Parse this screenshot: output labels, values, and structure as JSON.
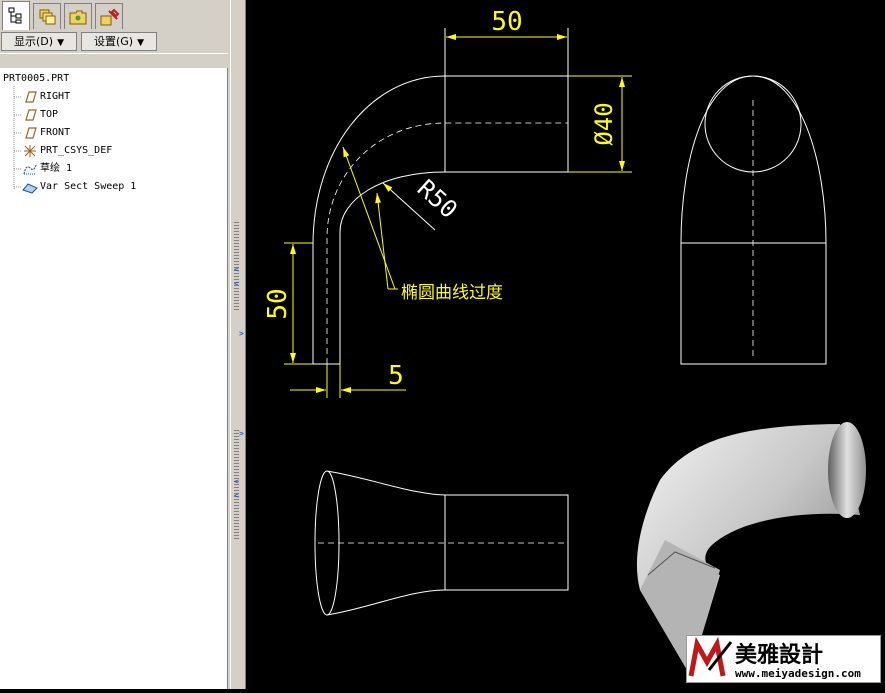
{
  "tabs": [
    {
      "name": "model-tree-tab",
      "icon": "model-tree-icon",
      "active": true
    },
    {
      "name": "layers-tab",
      "icon": "layers-icon",
      "active": false
    },
    {
      "name": "folder-browser-tab",
      "icon": "folder-icon",
      "active": false
    },
    {
      "name": "favorites-tab",
      "icon": "tools-icon",
      "active": false
    }
  ],
  "menus": {
    "show_label": "显示(D)",
    "settings_label": "设置(G)"
  },
  "tree": {
    "root": "PRT0005.PRT",
    "items": [
      {
        "label": "RIGHT",
        "icon": "datum-plane-icon"
      },
      {
        "label": "TOP",
        "icon": "datum-plane-icon"
      },
      {
        "label": "FRONT",
        "icon": "datum-plane-icon"
      },
      {
        "label": "PRT_CSYS_DEF",
        "icon": "csys-icon"
      },
      {
        "label": "草绘 1",
        "icon": "sketch-icon"
      },
      {
        "label": "Var Sect Sweep 1",
        "icon": "sweep-icon"
      }
    ]
  },
  "drawing": {
    "dim_top": "50",
    "dim_dia": "Ø40",
    "dim_radius": "R50",
    "dim_left": "50",
    "dim_bottom": "5",
    "note": "椭圆曲线过度"
  },
  "colors": {
    "line_white": "#ffffff",
    "dim_yellow": "#ffff00",
    "background": "#000000"
  },
  "watermark": {
    "brand_cn": "美雅設計",
    "url": "www.meiyadesign.com"
  }
}
